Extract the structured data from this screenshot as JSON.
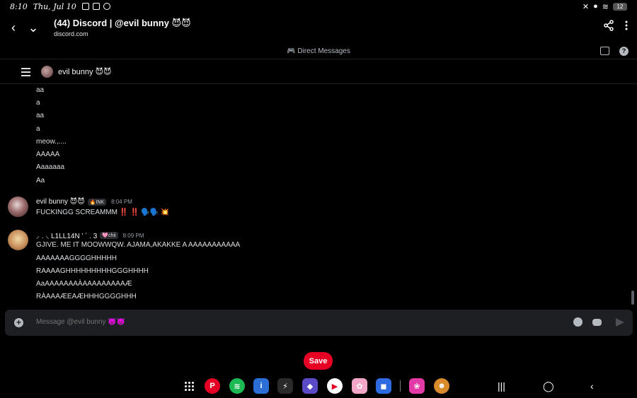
{
  "statusbar": {
    "time": "8:10",
    "date": "Thu, Jul 10",
    "battery": "12"
  },
  "browser": {
    "title": "(44) Discord | @evil bunny 😈😈",
    "url": "discord.com"
  },
  "dm_bar": {
    "label": "Direct Messages"
  },
  "channel": {
    "name": "evil bunny 😈😈"
  },
  "messages": {
    "continued_lines": [
      "aa",
      "a",
      "aa",
      "a",
      "meow.,....",
      "AAAAA",
      "Aaaaaaa",
      "Aa"
    ],
    "msg1": {
      "username": "evil bunny 😈😈",
      "tag": "🔥INK",
      "time": "8:04 PM",
      "text": "FUCKINGG SCREAMMM ‼️ ‼️ 🗣️🗣️ 💥"
    },
    "msg2": {
      "username": "⸝ . ⸜ L1LL14N ’ ˋ . 3",
      "tag": "🩷chii",
      "time": "8:09 PM",
      "lines": [
        "GJIVE. ME IT MOOWWQW.  AJAMA,AKAKKE A AAAAAAAAAAA",
        "AAAAAAAGGGGHHHHH",
        "RAAAAGHHHHHHHHHGGGHHHH",
        "AaAAAAAAAÀAAAAAAAAAÆ",
        "RÀAAAÆEAÆHHHGGGGHHH"
      ]
    }
  },
  "composer": {
    "placeholder": "Message @evil bunny 😈😈"
  },
  "save_button": {
    "label": "Save"
  },
  "dock": {
    "apps": [
      "pinterest",
      "spotify",
      "ibis-paint",
      "ai-app",
      "game-app",
      "youtube",
      "anime-app",
      "roblox",
      "flower-app",
      "monkey-app"
    ]
  },
  "colors": {
    "accent": "#e60023",
    "background": "#000000",
    "composer": "#1e1f22"
  }
}
